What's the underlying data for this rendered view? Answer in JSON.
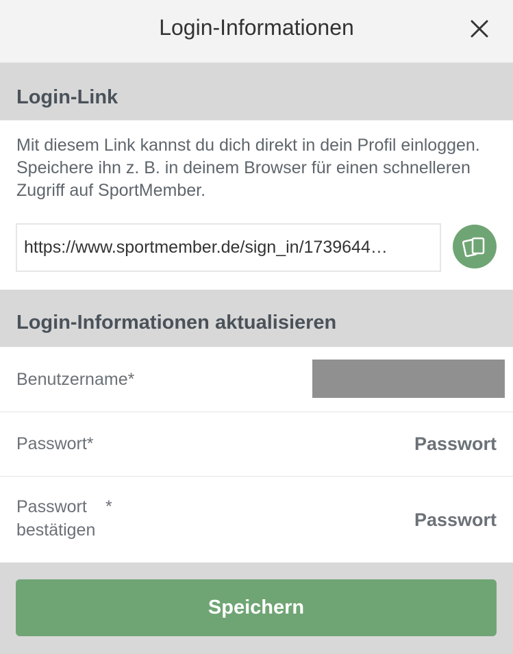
{
  "header": {
    "title": "Login-Informationen",
    "close_icon": "close-icon"
  },
  "login_link": {
    "section_title": "Login-Link",
    "description": "Mit diesem Link kannst du dich direkt in dein Profil einloggen. Speichere ihn z. B. in deinem Browser für einen schnelleren Zugriff auf SportMember.",
    "url_value": "https://www.sportmember.de/sign_in/1739644…",
    "copy_icon": "copy-icon"
  },
  "update": {
    "section_title": "Login-Informationen aktualisieren",
    "username_label": "Benutzername*",
    "password_label": "Passwort*",
    "password_placeholder": "Passwort",
    "confirm_label_line1": "Passwort",
    "confirm_star": "*",
    "confirm_label_line2": "bestätigen",
    "confirm_placeholder": "Passwort"
  },
  "footer": {
    "save_label": "Speichern"
  },
  "colors": {
    "accent_green": "#6fa574",
    "section_gray": "#d8d8d8",
    "header_bg": "#f3f3f3",
    "redacted_gray": "#909090"
  }
}
